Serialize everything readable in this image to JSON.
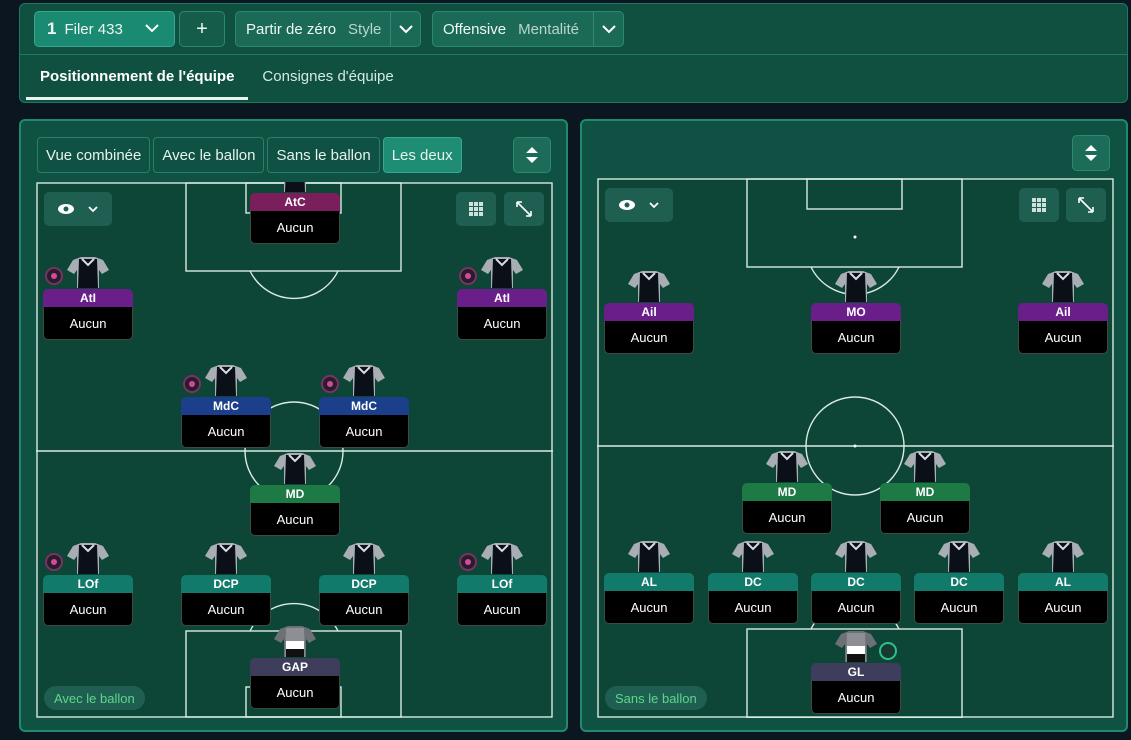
{
  "header": {
    "tactic_number": "1",
    "tactic_name": "Filer 433",
    "add_label": "+",
    "style_value": "Partir de zéro",
    "style_label": "Style",
    "mentality_value": "Offensive",
    "mentality_label": "Mentalité",
    "tabs": [
      {
        "label": "Positionnement de l'équipe",
        "active": true
      },
      {
        "label": "Consignes d'équipe",
        "active": false
      }
    ]
  },
  "left_panel": {
    "view_buttons": [
      {
        "label": "Vue combinée",
        "active": false
      },
      {
        "label": "Avec le ballon",
        "active": false
      },
      {
        "label": "Sans le ballon",
        "active": false
      },
      {
        "label": "Les deux",
        "active": true
      }
    ],
    "phase_label": "Avec le ballon",
    "players": [
      {
        "pos": "AtC",
        "role": "Aucun",
        "color": "#7a1f5c"
      },
      {
        "pos": "AtI",
        "role": "Aucun",
        "color": "#6a1e8a"
      },
      {
        "pos": "AtI",
        "role": "Aucun",
        "color": "#6a1e8a"
      },
      {
        "pos": "MdC",
        "role": "Aucun",
        "color": "#1c3f8c"
      },
      {
        "pos": "MdC",
        "role": "Aucun",
        "color": "#1c3f8c"
      },
      {
        "pos": "MD",
        "role": "Aucun",
        "color": "#1d7a45"
      },
      {
        "pos": "LOf",
        "role": "Aucun",
        "color": "#127a6a"
      },
      {
        "pos": "DCP",
        "role": "Aucun",
        "color": "#127a6a"
      },
      {
        "pos": "DCP",
        "role": "Aucun",
        "color": "#127a6a"
      },
      {
        "pos": "LOf",
        "role": "Aucun",
        "color": "#127a6a"
      },
      {
        "pos": "GAP",
        "role": "Aucun",
        "color": "#3e3e5c"
      }
    ]
  },
  "right_panel": {
    "phase_label": "Sans le ballon",
    "players": [
      {
        "pos": "Ail",
        "role": "Aucun",
        "color": "#6a1e8a"
      },
      {
        "pos": "MO",
        "role": "Aucun",
        "color": "#6a1e8a"
      },
      {
        "pos": "Ail",
        "role": "Aucun",
        "color": "#6a1e8a"
      },
      {
        "pos": "MD",
        "role": "Aucun",
        "color": "#1d7a45"
      },
      {
        "pos": "MD",
        "role": "Aucun",
        "color": "#1d7a45"
      },
      {
        "pos": "AL",
        "role": "Aucun",
        "color": "#127a6a"
      },
      {
        "pos": "DC",
        "role": "Aucun",
        "color": "#127a6a"
      },
      {
        "pos": "DC",
        "role": "Aucun",
        "color": "#127a6a"
      },
      {
        "pos": "DC",
        "role": "Aucun",
        "color": "#127a6a"
      },
      {
        "pos": "AL",
        "role": "Aucun",
        "color": "#127a6a"
      },
      {
        "pos": "GL",
        "role": "Aucun",
        "color": "#3e3e5c"
      }
    ]
  },
  "colors": {
    "accent": "#1f8c74",
    "pitch": "#0d4536",
    "phase_text": "#5fd68a"
  }
}
